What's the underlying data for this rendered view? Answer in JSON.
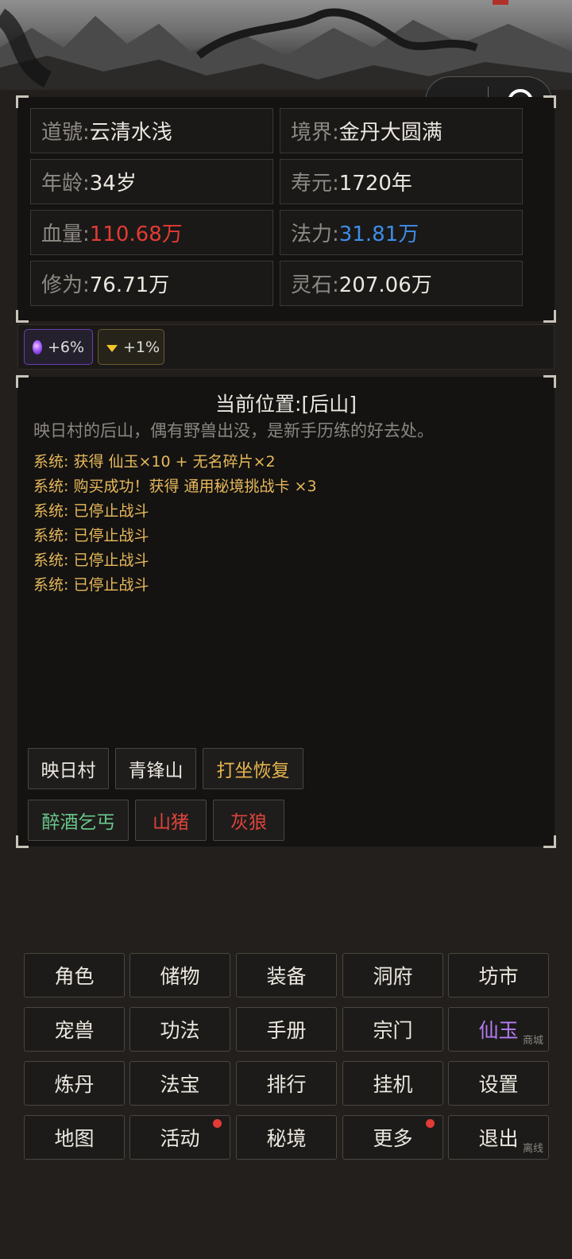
{
  "capsule": {
    "more_icon": "more-dots-icon",
    "close_icon": "target-circle-icon"
  },
  "stats": [
    {
      "key": "道號: ",
      "value": "云清水浅",
      "color": ""
    },
    {
      "key": "境界: ",
      "value": "金丹大圆满",
      "color": ""
    },
    {
      "key": "年龄: ",
      "value": "34岁",
      "color": ""
    },
    {
      "key": "寿元: ",
      "value": "1720年",
      "color": ""
    },
    {
      "key": "血量: ",
      "value": "110.68万",
      "color": "#e23b35"
    },
    {
      "key": "法力: ",
      "value": "31.81万",
      "color": "#3f8ce6"
    },
    {
      "key": "修为: ",
      "value": "76.71万",
      "color": ""
    },
    {
      "key": "灵石: ",
      "value": "207.06万",
      "color": ""
    }
  ],
  "buffs": [
    {
      "icon": "purple-orb-icon",
      "label": "+6%"
    },
    {
      "icon": "gold-gem-icon",
      "label": "+1%"
    }
  ],
  "scene": {
    "title": "当前位置:[后山]",
    "desc": "映日村的后山，偶有野兽出没，是新手历练的好去处。",
    "log": [
      "系统: 获得 仙玉×10 + 无名碎片×2",
      "系统: 购买成功！获得 通用秘境挑战卡 ×3",
      "系统: 已停止战斗",
      "系统: 已停止战斗",
      "系统: 已停止战斗",
      "系统: 已停止战斗"
    ],
    "actions_row1": [
      "映日村",
      "青锋山",
      "打坐恢复"
    ],
    "actions_row2": [
      "醉酒乞丐",
      "山猪",
      "灰狼"
    ]
  },
  "menu": [
    {
      "label": "角色"
    },
    {
      "label": "储物"
    },
    {
      "label": "装备"
    },
    {
      "label": "洞府"
    },
    {
      "label": "坊市"
    },
    {
      "label": "宠兽"
    },
    {
      "label": "功法"
    },
    {
      "label": "手册"
    },
    {
      "label": "宗门"
    },
    {
      "label": "仙玉",
      "sub": "商城",
      "color": "#b57cf2"
    },
    {
      "label": "炼丹"
    },
    {
      "label": "法宝"
    },
    {
      "label": "排行"
    },
    {
      "label": "挂机"
    },
    {
      "label": "设置"
    },
    {
      "label": "地图"
    },
    {
      "label": "活动",
      "badge": true
    },
    {
      "label": "秘境"
    },
    {
      "label": "更多",
      "badge": true
    },
    {
      "label": "退出",
      "sub": "离线"
    }
  ]
}
